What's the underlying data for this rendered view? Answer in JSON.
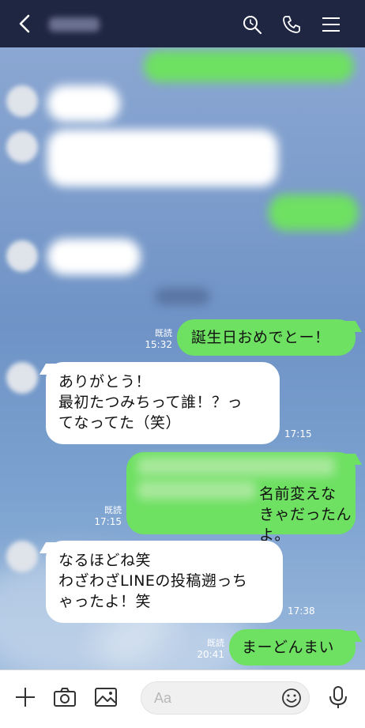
{
  "header": {
    "back_icon": "chevron-left-icon",
    "contact_name": "●●●",
    "search_icon": "search-icon",
    "call_icon": "phone-icon",
    "menu_icon": "menu-icon"
  },
  "messages": [
    {
      "side": "out",
      "text": "誕生日おめでとー！",
      "read": "既読",
      "time": "15:32"
    },
    {
      "side": "in",
      "text": "ありがとう！\n最初たつみちって誰！？っ\nてなってた（笑）",
      "time": "17:15"
    },
    {
      "side": "out",
      "text": "名前変えな\nきゃだったんよ。",
      "read": "既読",
      "time": "17:15"
    },
    {
      "side": "in",
      "text": "なるほどね笑\nわざわざLINEの投稿遡っち\nゃったよ！笑",
      "time": "17:38"
    },
    {
      "side": "out",
      "text": "まーどんまい",
      "read": "既読",
      "time": "20:41"
    }
  ],
  "input": {
    "placeholder": "Aa"
  },
  "colors": {
    "header_bg": "#1f2642",
    "outgoing_bubble": "#6ee062",
    "incoming_bubble": "#ffffff",
    "chat_bg": "#7a9ac8"
  }
}
